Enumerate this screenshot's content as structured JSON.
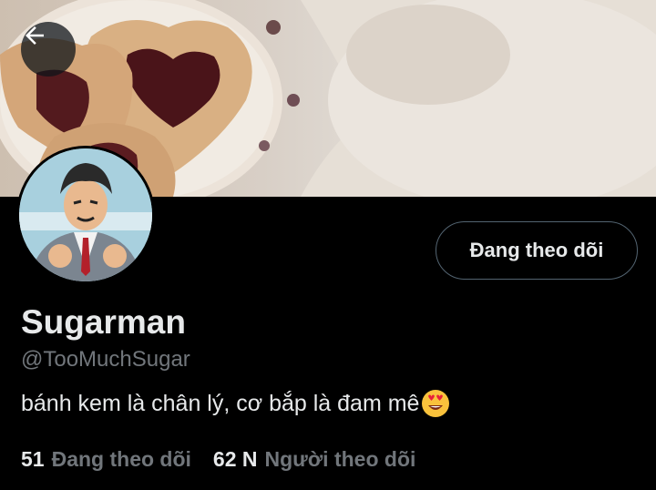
{
  "profile": {
    "display_name": "Sugarman",
    "handle": "@TooMuchSugar",
    "bio": "bánh kem là chân lý, cơ bắp là đam mê",
    "bio_emoji": "heart-eyes-emoji"
  },
  "actions": {
    "follow_state_label": "Đang theo dõi",
    "back_icon": "arrow-left-icon"
  },
  "stats": {
    "following_count": "51",
    "following_label": "Đang theo dõi",
    "followers_count": "62 N",
    "followers_label": "Người theo dõi"
  },
  "colors": {
    "background": "#000000",
    "primary_text": "#e7e9ea",
    "secondary_text": "#71767b",
    "button_border": "#536471"
  }
}
